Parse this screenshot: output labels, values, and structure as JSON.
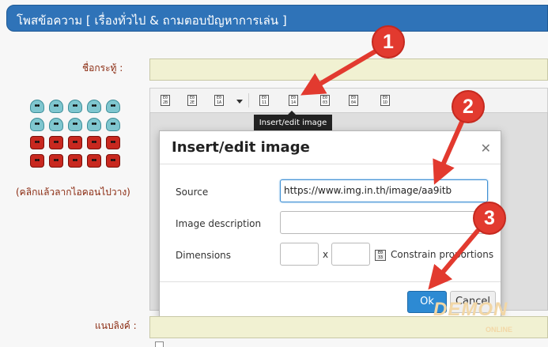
{
  "header": {
    "title": "โพสข้อความ [ เรื่องทั่วไป & ถามตอบปัญหาการเล่น ]"
  },
  "form": {
    "subject_label": "ชื่อกระทู้ :",
    "attach_label": "แนบลิงค์ :",
    "emoticon_hint": "(คลิกแล้วลากไอคอนไปวาง)"
  },
  "emoticons": {
    "rows": [
      [
        "blue",
        "blue",
        "blue",
        "blue",
        "blue"
      ],
      [
        "blue",
        "blue",
        "blue",
        "blue",
        "blue"
      ],
      [
        "red",
        "red",
        "red",
        "red",
        "red"
      ],
      [
        "red",
        "red",
        "red",
        "red",
        "red"
      ]
    ]
  },
  "toolbar": {
    "buttons": [
      "E0 2B",
      "E0 2E",
      "E0 1A",
      "E0 11",
      "E0 14",
      "E0 03",
      "E0 04",
      "E0 1D"
    ],
    "tooltip": "Insert/edit image"
  },
  "dialog": {
    "title": "Insert/edit image",
    "close_icon": "close-icon",
    "source_label": "Source",
    "source_value": "https://www.img.in.th/image/aa9itb",
    "description_label": "Image description",
    "description_value": "",
    "dimensions_label": "Dimensions",
    "width_value": "",
    "height_value": "",
    "dimension_separator": "x",
    "constrain_label": "Constrain proportions",
    "constrain_icon": "E0 33",
    "ok_label": "Ok",
    "cancel_label": "Cancel"
  },
  "annotations": {
    "steps": [
      "1",
      "2",
      "3"
    ],
    "color": "#e23a2f"
  },
  "watermark": {
    "text": "DEMON",
    "sub": "ONLINE"
  },
  "colors": {
    "header": "#2f73b8",
    "label": "#8a2a10",
    "field": "#f1f1d2",
    "ok": "#2d8ad3"
  }
}
